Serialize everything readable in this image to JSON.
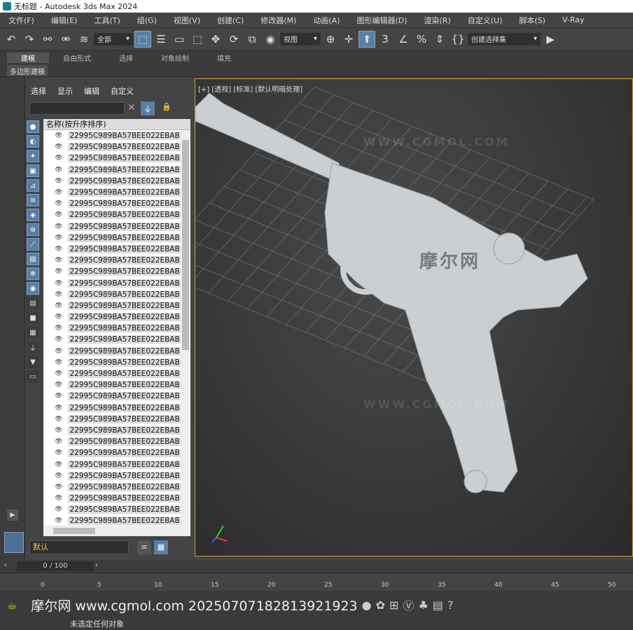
{
  "window": {
    "title": "无标题 - Autodesk 3ds Max 2024"
  },
  "menu": [
    "文件(F)",
    "编辑(E)",
    "工具(T)",
    "组(G)",
    "视图(V)",
    "创建(C)",
    "修改器(M)",
    "动画(A)",
    "图形编辑器(D)",
    "渲染(R)",
    "自定义(U)",
    "脚本(S)",
    "V-Ray"
  ],
  "toolbar": {
    "selection_filter": "全部",
    "ref_coord": "视图",
    "named_selection": "创建选择集"
  },
  "ribbon": {
    "tabs": [
      "建模",
      "自由形式",
      "选择",
      "对象绘制",
      "填充"
    ],
    "subtab": "多边形建模"
  },
  "scene_explorer": {
    "tabs": [
      "选择",
      "显示",
      "编辑",
      "自定义"
    ],
    "column_header": "名称(按升序排序)",
    "rows": [
      "22995C989BA57BEE022EBAB",
      "22995C989BA57BEE022EBAB",
      "22995C989BA57BEE022EBAB",
      "22995C989BA57BEE022EBAB",
      "22995C989BA57BEE022EBAB",
      "22995C989BA57BEE022EBAB",
      "22995C989BA57BEE022EBAB",
      "22995C989BA57BEE022EBAB",
      "22995C989BA57BEE022EBAB",
      "22995C989BA57BEE022EBAB",
      "22995C989BA57BEE022EBAB",
      "22995C989BA57BEE022EBAB",
      "22995C989BA57BEE022EBAB",
      "22995C989BA57BEE022EBAB",
      "22995C989BA57BEE022EBAB",
      "22995C989BA57BEE022EBAB",
      "22995C989BA57BEE022EBAB",
      "22995C989BA57BEE022EBAB",
      "22995C989BA57BEE022EBAB",
      "22995C989BA57BEE022EBAB",
      "22995C989BA57BEE022EBAB",
      "22995C989BA57BEE022EBAB",
      "22995C989BA57BEE022EBAB",
      "22995C989BA57BEE022EBAB",
      "22995C989BA57BEE022EBAB",
      "22995C989BA57BEE022EBAB",
      "22995C989BA57BEE022EBAB",
      "22995C989BA57BEE022EBAB",
      "22995C989BA57BEE022EBAB",
      "22995C989BA57BEE022EBAB",
      "22995C989BA57BEE022EBAB",
      "22995C989BA57BEE022EBAB",
      "22995C989BA57BEE022EBAB",
      "22995C989BA57BEE022EBAB",
      "22995C989BA57BEE022EBAB"
    ],
    "layer": "默认"
  },
  "viewport": {
    "label": "[+] [透视] [标准] [默认明暗处理]"
  },
  "time": {
    "slider": "0 / 100",
    "ticks": [
      "0",
      "5",
      "10",
      "15",
      "20",
      "25",
      "30",
      "35",
      "40",
      "45",
      "50"
    ]
  },
  "watermarks": {
    "site": "WWW.CGMOL.COM",
    "brand": "摩尔网",
    "footer": "摩尔网 www.cgmol.com 20250707182813921923"
  },
  "status": "未选定任何对象"
}
